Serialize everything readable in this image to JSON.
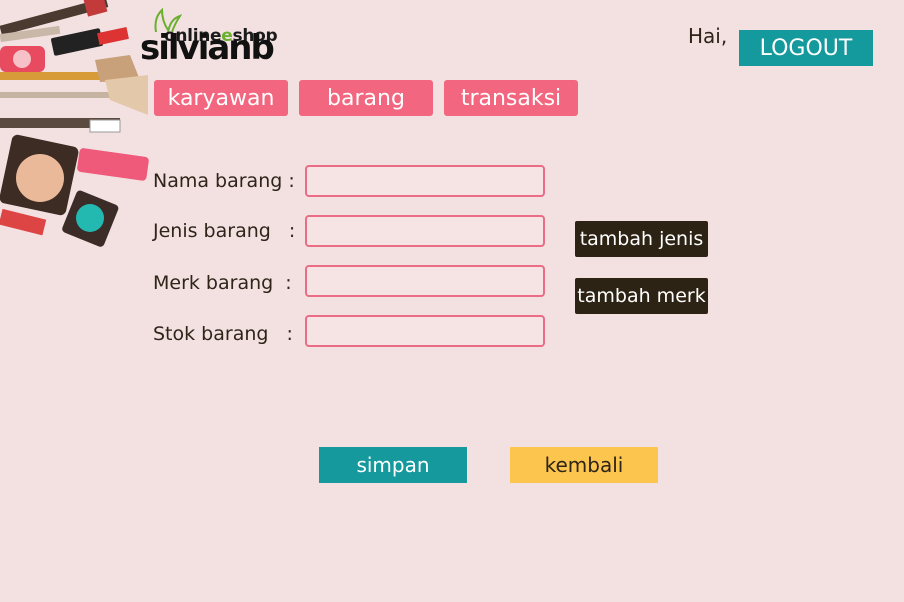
{
  "logo": {
    "top": "onlineshop",
    "top_o": "e",
    "main": "silvianb"
  },
  "header": {
    "greeting": "Hai,",
    "logout_label": "LOGOUT"
  },
  "tabs": [
    {
      "label": "karyawan"
    },
    {
      "label": "barang"
    },
    {
      "label": "transaksi"
    }
  ],
  "form": {
    "fields": [
      {
        "label": "Nama barang :",
        "value": ""
      },
      {
        "label": "Jenis barang   :",
        "value": ""
      },
      {
        "label": "Merk barang  :",
        "value": ""
      },
      {
        "label": "Stok barang   :",
        "value": ""
      }
    ],
    "tambah_jenis": "tambah jenis",
    "tambah_merk": "tambah merk"
  },
  "actions": {
    "simpan": "simpan",
    "kembali": "kembali"
  },
  "colors": {
    "background": "#f3e1e2",
    "pink": "#f2677f",
    "teal": "#14999c",
    "dark": "#2d2314",
    "yellow": "#fcc54e"
  },
  "icons": {
    "decoration": "makeup-illustration",
    "logo_leaf": "leaf-icon"
  }
}
